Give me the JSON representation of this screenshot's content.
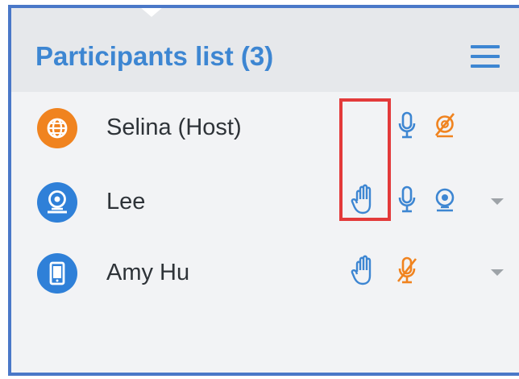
{
  "panel": {
    "title": "Participants list (3)",
    "menu_icon": "hamburger-menu-icon"
  },
  "colors": {
    "accent_blue": "#3d86d2",
    "host_orange": "#f0831f",
    "muted_orange": "#f0831f",
    "highlight_red": "#e33a3a"
  },
  "participants": [
    {
      "name": "Selina (Host)",
      "avatar_icon": "globe-icon",
      "mic_icon": "microphone-icon",
      "video_icon": "video-off-icon"
    },
    {
      "name": "Lee",
      "avatar_icon": "webcam-user-icon",
      "hand_icon": "raised-hand-icon",
      "mic_icon": "microphone-icon",
      "video_icon": "webcam-icon",
      "menu_icon": "chevron-down-icon"
    },
    {
      "name": "Amy  Hu",
      "avatar_icon": "mobile-phone-icon",
      "hand_icon": "raised-hand-icon",
      "mic_icon": "microphone-muted-icon",
      "menu_icon": "chevron-down-icon"
    }
  ]
}
